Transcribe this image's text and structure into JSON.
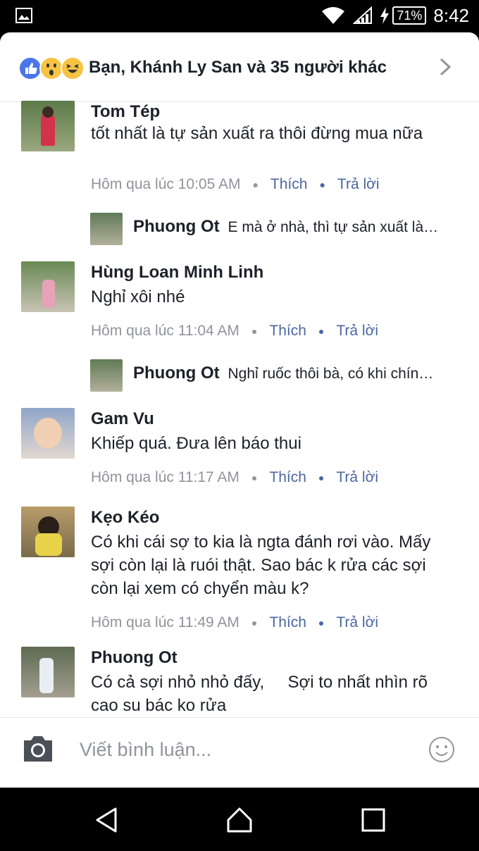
{
  "status_bar": {
    "battery": "71%",
    "time": "8:42"
  },
  "reactions": {
    "summary": "Bạn, Khánh Ly San và 35 người khác"
  },
  "comments": [
    {
      "name": "Tom Tép",
      "text": "tốt nhất là tự sản xuất ra thôi đừng mua nữa",
      "time": "Hôm qua lúc 10:05 AM",
      "like": "Thích",
      "reply": "Trả lời",
      "reply_preview": {
        "name": "Phuong Ot",
        "text": "E mà ở nhà, thì tự sản xuất là…"
      }
    },
    {
      "name": "Hùng Loan Minh Linh",
      "text": "Nghỉ xôi nhé",
      "time": "Hôm qua lúc 11:04 AM",
      "like": "Thích",
      "reply": "Trả lời",
      "reply_preview": {
        "name": "Phuong Ot",
        "text": "Nghỉ ruốc thôi bà, có khi chín…"
      }
    },
    {
      "name": "Gam Vu",
      "text": "Khiếp quá. Đưa lên báo thui",
      "time": "Hôm qua lúc 11:17 AM",
      "like": "Thích",
      "reply": "Trả lời"
    },
    {
      "name": "Kẹo Kéo",
      "text": "Có khi cái sợ to kia là ngta đánh rơi vào. Mấy sợi còn lại là ruói thật. Sao bác k rửa các sợi còn lại xem có chyển màu k?",
      "time": "Hôm qua lúc 11:49 AM",
      "like": "Thích",
      "reply": "Trả lời"
    },
    {
      "name": "Phuong Ot",
      "text": "Có cả sợi nhỏ nhỏ đấy,     Sợi to nhất nhìn rõ cao su bác ko rửa"
    }
  ],
  "composer": {
    "placeholder": "Viết bình luận..."
  },
  "icons": {
    "status_left": "image-notification-icon",
    "wifi": "wifi-icon",
    "signal": "signal-icon",
    "charging": "charging-icon",
    "chevron": "chevron-right-icon",
    "camera": "camera-icon",
    "emoji": "emoji-icon",
    "nav": [
      "back-icon",
      "home-icon",
      "recents-icon"
    ]
  },
  "colors": {
    "link": "#4b67a1",
    "meta": "#90949c",
    "like_blue": "#4a76e8"
  }
}
